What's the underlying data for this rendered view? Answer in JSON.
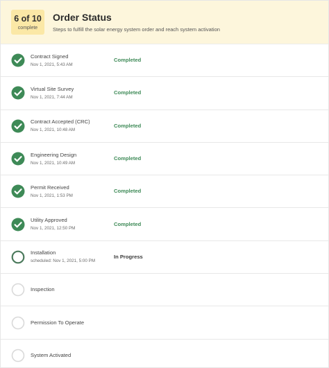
{
  "header": {
    "count": "6 of 10",
    "count_sub": "complete",
    "title": "Order Status",
    "subtitle": "Steps to fulfill the solar energy system order and reach system activation"
  },
  "colors": {
    "header_bg": "#fdf6dc",
    "count_bg": "#fbe8a6",
    "completed_green": "#3e8a57",
    "progress_ring": "#4b7a5c",
    "pending_ring": "#d9d9d9"
  },
  "steps": [
    {
      "name": "Contract Signed",
      "date": "Nov 1, 2021, 5:43 AM",
      "status": "Completed",
      "state": "completed",
      "icon": "check-circle-icon"
    },
    {
      "name": "Virtual Site Survey",
      "date": "Nov 1, 2021, 7:44 AM",
      "status": "Completed",
      "state": "completed",
      "icon": "check-circle-icon"
    },
    {
      "name": "Contract Accepted (CRC)",
      "date": "Nov 1, 2021, 10:48 AM",
      "status": "Completed",
      "state": "completed",
      "icon": "check-circle-icon"
    },
    {
      "name": "Engineering Design",
      "date": "Nov 1, 2021, 10:49 AM",
      "status": "Completed",
      "state": "completed",
      "icon": "check-circle-icon"
    },
    {
      "name": "Permit Received",
      "date": "Nov 1, 2021, 1:53 PM",
      "status": "Completed",
      "state": "completed",
      "icon": "check-circle-icon"
    },
    {
      "name": "Utility Approved",
      "date": "Nov 1, 2021, 12:50 PM",
      "status": "Completed",
      "state": "completed",
      "icon": "check-circle-icon"
    },
    {
      "name": "Installation",
      "date": "scheduled: Nov 1, 2021, 5:00 PM",
      "status": "In Progress",
      "state": "progress",
      "icon": "progress-circle-icon"
    },
    {
      "name": "Inspection",
      "date": "",
      "status": "",
      "state": "pending",
      "icon": "empty-circle-icon"
    },
    {
      "name": "Permission To Operate",
      "date": "",
      "status": "",
      "state": "pending",
      "icon": "empty-circle-icon"
    },
    {
      "name": "System Activated",
      "date": "",
      "status": "",
      "state": "pending",
      "icon": "empty-circle-icon"
    }
  ]
}
